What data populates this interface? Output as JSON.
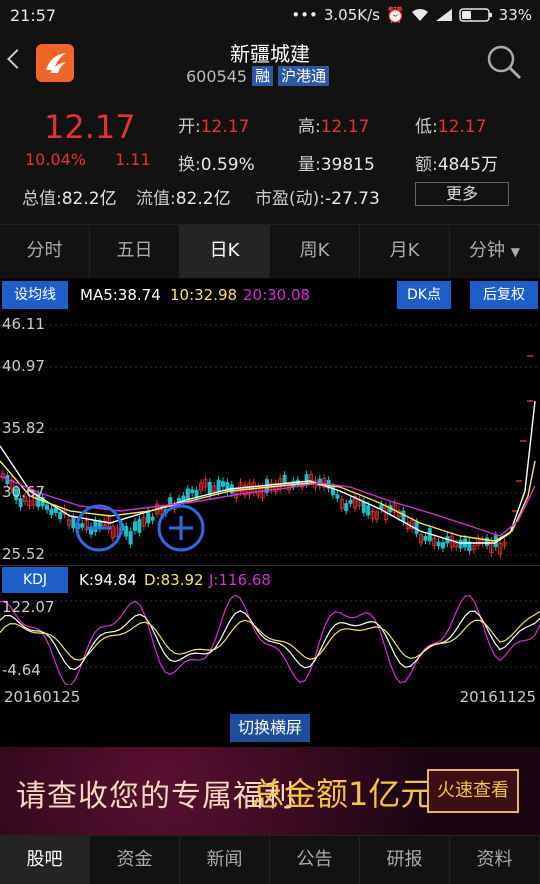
{
  "status_bar": {
    "time": "21:57",
    "dots": "•••",
    "net_speed": "3.05K/s",
    "battery": "33%"
  },
  "header": {
    "title": "新疆城建",
    "code": "600545",
    "tags": [
      "融",
      "沪港通"
    ]
  },
  "quote": {
    "price": "12.17",
    "change_pct": "10.04%",
    "change": "1.11",
    "open_label": "开:",
    "open": "12.17",
    "high_label": "高:",
    "high": "12.17",
    "low_label": "低:",
    "low": "12.17",
    "turnover_label": "换:",
    "turnover": "0.59%",
    "volume_label": "量:",
    "volume": "39815",
    "amount_label": "额:",
    "amount": "4845万",
    "total_cap_label": "总值:",
    "total_cap": "82.2亿",
    "float_cap_label": "流值:",
    "float_cap": "82.2亿",
    "pe_label": "市盈(动):",
    "pe": "-27.73",
    "more_label": "更多"
  },
  "tabs": [
    {
      "label": "分时"
    },
    {
      "label": "五日"
    },
    {
      "label": "日K"
    },
    {
      "label": "周K"
    },
    {
      "label": "月K"
    },
    {
      "label": "分钟"
    }
  ],
  "ma": {
    "setting_label": "设均线",
    "ma5": "MA5:38.74",
    "ma10": "10:32.98",
    "ma20": "20:30.08",
    "dk_label": "DK点",
    "adjust_label": "后复权"
  },
  "price_axis": [
    "46.11",
    "40.97",
    "35.82",
    "30.67",
    "25.52"
  ],
  "kdj": {
    "label": "KDJ",
    "k": "K:94.84",
    "d": "D:83.92",
    "j": "J:116.68",
    "axis_top": "122.07",
    "axis_bottom": "-4.64"
  },
  "dates": {
    "start": "20160125",
    "end": "20161125"
  },
  "switch_label": "切换横屏",
  "ad": {
    "text1": "请查收您的专属福利",
    "text2": "总金额1亿元",
    "cta": "火速查看"
  },
  "bottom_nav": [
    {
      "label": "股吧"
    },
    {
      "label": "资金"
    },
    {
      "label": "新闻"
    },
    {
      "label": "公告"
    },
    {
      "label": "研报"
    },
    {
      "label": "资料"
    }
  ],
  "colors": {
    "up": "#e23232",
    "down": "#19c0c8",
    "ma5": "#ffffff",
    "ma10": "#f5e663",
    "ma20": "#d530d8",
    "accent": "#1e5ec8"
  }
}
